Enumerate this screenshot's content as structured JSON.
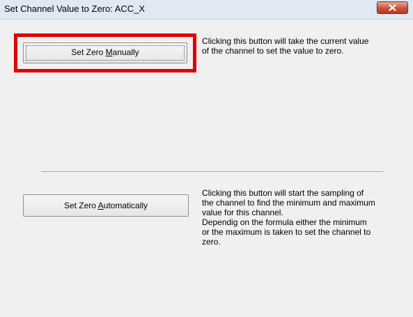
{
  "window": {
    "title": "Set Channel Value to Zero: ACC_X"
  },
  "buttons": {
    "manual": {
      "before": "Set Zero ",
      "accel": "M",
      "after": "anually"
    },
    "auto": {
      "before": "Set Zero ",
      "accel": "A",
      "after": "utomatically"
    }
  },
  "descriptions": {
    "manual": [
      "Clicking this button will take the current value",
      "of the channel to set the value to zero."
    ],
    "auto": [
      "Clicking this button will start the sampling of",
      "the channel to find the minimum and maximum",
      "value for this channel.",
      "Dependig on the formula either the minimum",
      "or the maximum is taken to set the channel to",
      "zero."
    ]
  },
  "icons": {
    "close": "close-icon"
  },
  "colors": {
    "highlight": "#e00000",
    "close_button": "#c7533b",
    "dialog_background": "#f0f0f0"
  }
}
